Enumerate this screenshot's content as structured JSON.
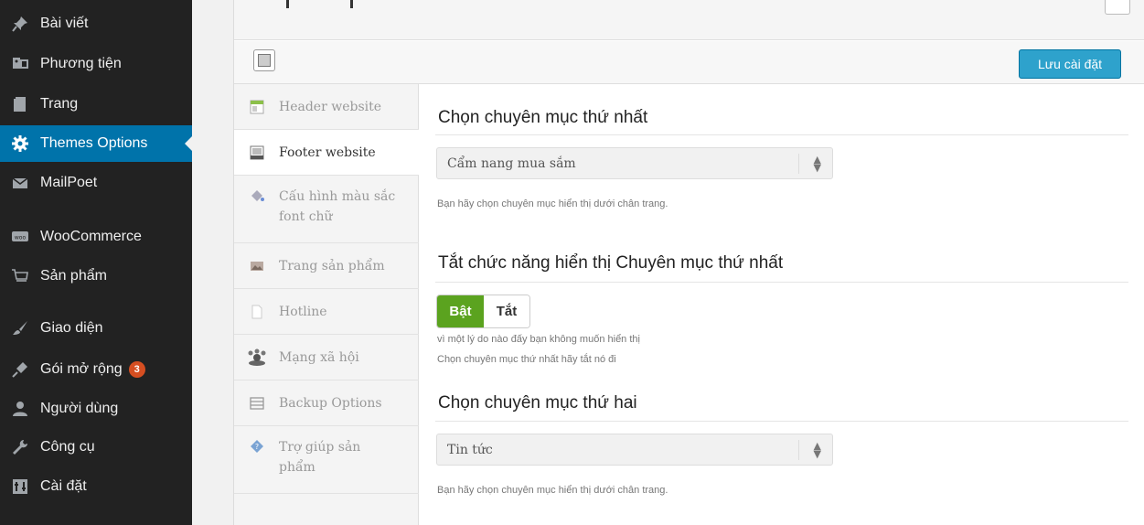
{
  "sidebar": {
    "items": [
      {
        "label": "Bài viết",
        "icon": "pin-icon"
      },
      {
        "label": "Phương tiện",
        "icon": "media-icon"
      },
      {
        "label": "Trang",
        "icon": "page-icon"
      },
      {
        "label": "Themes Options",
        "icon": "gear-icon",
        "active": true
      },
      {
        "label": "MailPoet",
        "icon": "envelope-icon"
      },
      {
        "label": "WooCommerce",
        "icon": "woo-icon"
      },
      {
        "label": "Sản phẩm",
        "icon": "cart-icon"
      },
      {
        "label": "Giao diện",
        "icon": "brush-icon"
      },
      {
        "label": "Gói mở rộng",
        "icon": "plugin-icon",
        "badge": "3"
      },
      {
        "label": "Người dùng",
        "icon": "user-icon"
      },
      {
        "label": "Công cụ",
        "icon": "wrench-icon"
      },
      {
        "label": "Cài đặt",
        "icon": "settings-icon"
      }
    ]
  },
  "toolbar": {
    "save_label": "Lưu cài đặt"
  },
  "options_menu": {
    "items": [
      {
        "label": "Header website",
        "icon": "header-icon"
      },
      {
        "label": "Footer website",
        "icon": "footer-icon",
        "active": true
      },
      {
        "label": "Cấu hình màu sắc font chữ",
        "icon": "paint-bucket-icon"
      },
      {
        "label": "Trang sản phẩm",
        "icon": "product-image-icon"
      },
      {
        "label": "Hotline",
        "icon": "document-icon"
      },
      {
        "label": "Mạng xã hội",
        "icon": "social-network-icon"
      },
      {
        "label": "Backup Options",
        "icon": "backup-icon"
      },
      {
        "label": "Trợ giúp sản phẩm",
        "icon": "help-icon"
      }
    ]
  },
  "content": {
    "section1": {
      "title": "Chọn chuyên mục thứ nhất",
      "select_value": "Cẩm nang mua sắm",
      "desc": "Bạn hãy chọn chuyên mục hiển thị dưới chân trang."
    },
    "section2": {
      "title": "Tắt chức năng hiển thị Chuyên mục thứ nhất",
      "switch_on": "Bật",
      "switch_off": "Tắt",
      "switch_state": "on",
      "desc_line1": "vì một lý do nào đấy bạn không muốn hiển thị",
      "desc_line2": "Chọn chuyên mục thứ nhất hãy tắt nó đi"
    },
    "section3": {
      "title": "Chọn chuyên mục thứ hai",
      "select_value": "Tin tức",
      "desc": "Bạn hãy chọn chuyên mục hiển thị dưới chân trang."
    }
  },
  "colors": {
    "sidebar_bg": "#222222",
    "sidebar_active": "#0073aa",
    "save_button": "#2ea2cc",
    "switch_on": "#5ba31f",
    "badge": "#d54e21"
  }
}
